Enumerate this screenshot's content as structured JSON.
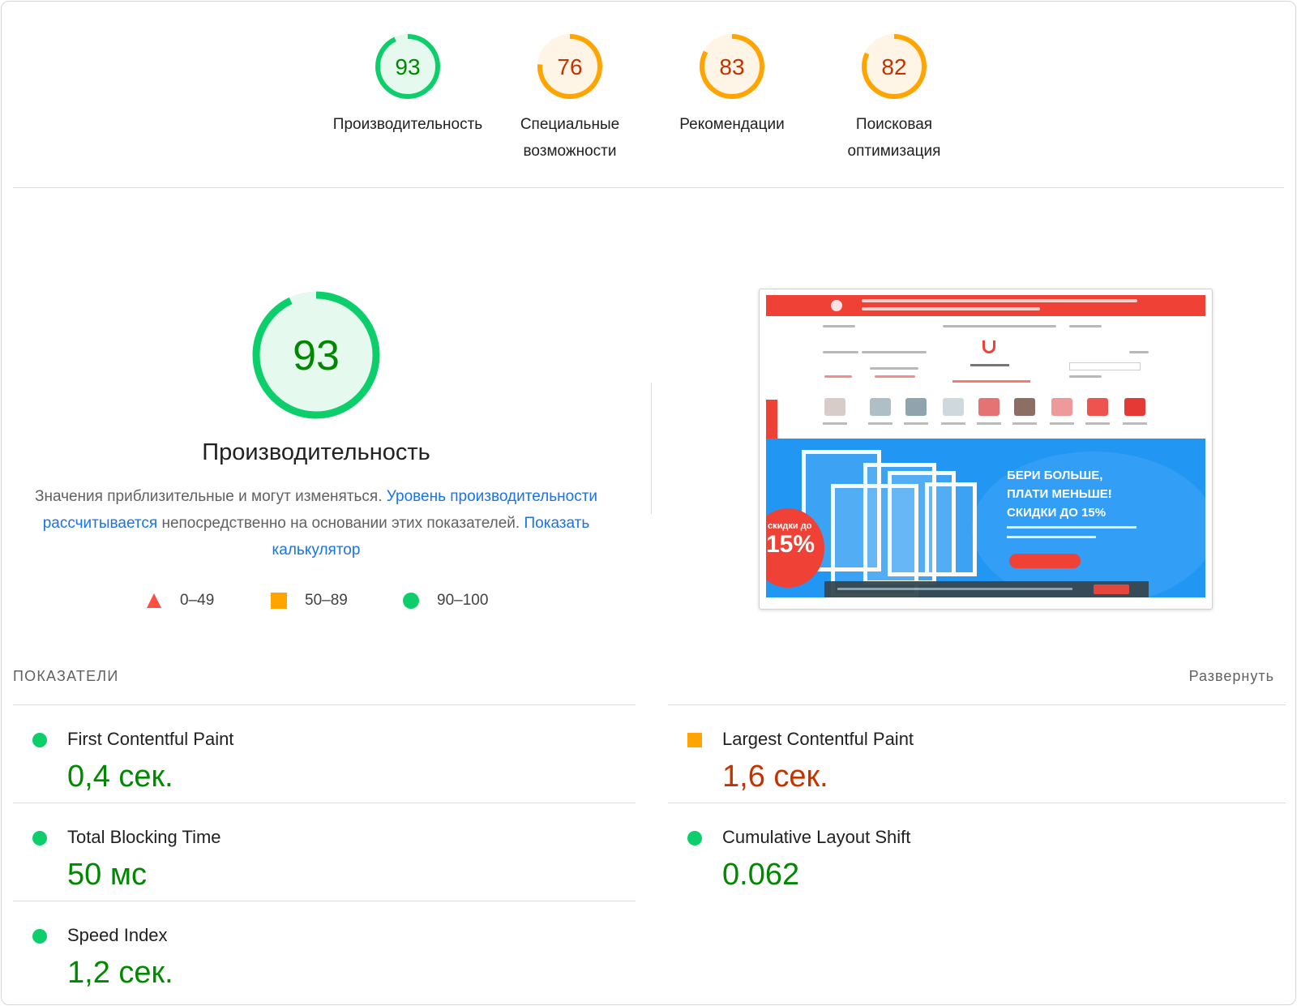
{
  "colors": {
    "pass": "#0cce6b",
    "pass_text": "#008800",
    "average": "#ffa400",
    "average_text": "#c33300",
    "fail": "#ff4e42",
    "link": "#1a73e8"
  },
  "categories": [
    {
      "score": 93,
      "label_lines": [
        "Производительность"
      ],
      "rating": "pass"
    },
    {
      "score": 76,
      "label_lines": [
        "Специальные",
        "возможности"
      ],
      "rating": "average"
    },
    {
      "score": 83,
      "label_lines": [
        "Рекомендации"
      ],
      "rating": "average"
    },
    {
      "score": 82,
      "label_lines": [
        "Поисковая",
        "оптимизация"
      ],
      "rating": "average"
    }
  ],
  "performance": {
    "score": 93,
    "title": "Производительность",
    "desc_text1": "Значения приблизительные и могут изменяться.",
    "desc_link1": "Уровень производительности рассчитывается",
    "desc_text2": "непосредственно на основании этих показателей.",
    "desc_link2": "Показать калькулятор"
  },
  "legend": [
    {
      "icon": "triangle-icon",
      "range": "0–49"
    },
    {
      "icon": "square-icon",
      "range": "50–89"
    },
    {
      "icon": "circle-icon",
      "range": "90–100"
    }
  ],
  "screenshot": {
    "hero_heading_lines": [
      "БЕРИ БОЛЬШЕ,",
      "ПЛАТИ МЕНЬШЕ!",
      "СКИДКИ ДО 15%"
    ],
    "badge_small": "скидки до",
    "badge_big": "15%"
  },
  "metrics_section": {
    "header": "ПОКАЗАТЕЛИ",
    "expand_label": "Развернуть"
  },
  "metrics": [
    {
      "name": "First Contentful Paint",
      "value": "0,4 сек.",
      "rating": "pass"
    },
    {
      "name": "Largest Contentful Paint",
      "value": "1,6 сек.",
      "rating": "average"
    },
    {
      "name": "Total Blocking Time",
      "value": "50 мс",
      "rating": "pass"
    },
    {
      "name": "Cumulative Layout Shift",
      "value": "0.062",
      "rating": "pass"
    },
    {
      "name": "Speed Index",
      "value": "1,2 сек.",
      "rating": "pass"
    }
  ]
}
